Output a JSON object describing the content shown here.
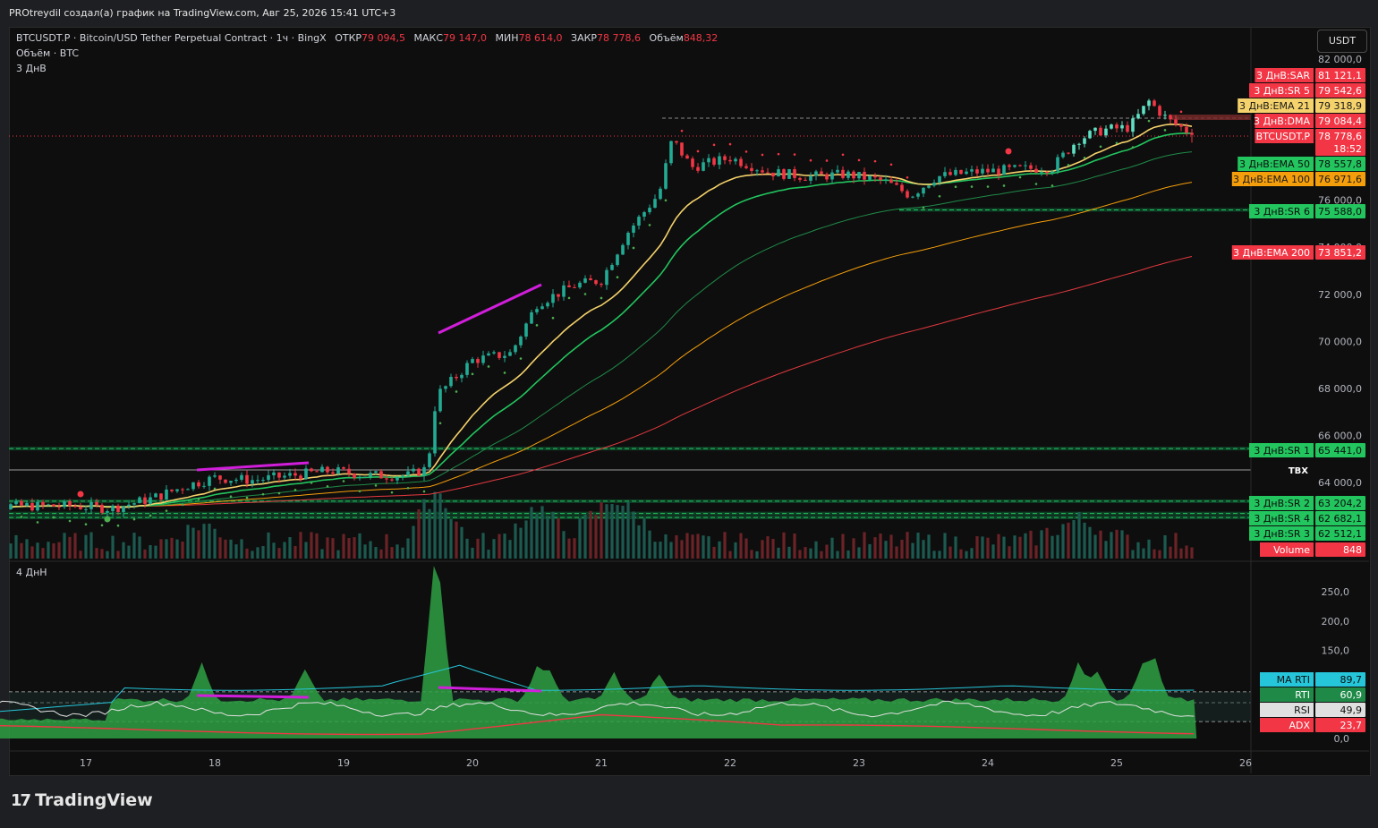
{
  "header": {
    "title": "PROtreydil создал(а) график на TradingView.com, Авг 25, 2026 15:41 UTC+3"
  },
  "legend": {
    "symbol": "BTCUSDT.P · Bitcoin/USD Tether Perpetual Contract · 1ч · BingX",
    "open_label": "ОТКР",
    "open_value": "79 094,5",
    "high_label": "МАКС",
    "high_value": "79 147,0",
    "low_label": "МИН",
    "low_value": "78 614,0",
    "close_label": "ЗАКР",
    "close_value": "78 778,6",
    "volume_label": "Объём",
    "volume_value": "848,32",
    "volume_line": "Объём · BTC",
    "indicator_main": "3 ДнВ",
    "indicator_sub": "4 ДнН"
  },
  "currency_button": "USDT",
  "colors": {
    "up": "#22ab94",
    "up_bright": "#5ee0c2",
    "down": "#f23645",
    "ema21": "#f5d26b",
    "ema50": "#22c55e",
    "ema100": "#f59e0b",
    "ema200": "#e5393f",
    "sar": "#f23645",
    "sr": "#22c55e",
    "magenta": "#d11edb",
    "bg": "#0e0e0e"
  },
  "chart_data": [
    {
      "type": "candlestick",
      "symbol": "BTCUSDT.P",
      "timeframe": "1ч",
      "x_ticks": [
        "17",
        "18",
        "19",
        "20",
        "21",
        "22",
        "23",
        "24",
        "25",
        "26"
      ],
      "y_ticks": [
        "82 000,0",
        "76 000,0",
        "74 000,0",
        "72 000,0",
        "70 000,0",
        "68 000,0",
        "66 000,0",
        "64 000,0"
      ],
      "ylim": [
        61000,
        82400
      ],
      "series_close": [
        {
          "day": 16.9,
          "price": 63000
        },
        {
          "day": 17.2,
          "price": 62900
        },
        {
          "day": 17.5,
          "price": 63300
        },
        {
          "day": 17.8,
          "price": 63900
        },
        {
          "day": 18.0,
          "price": 64200
        },
        {
          "day": 18.3,
          "price": 64100
        },
        {
          "day": 18.6,
          "price": 64300
        },
        {
          "day": 18.9,
          "price": 64500
        },
        {
          "day": 19.2,
          "price": 64300
        },
        {
          "day": 19.5,
          "price": 64300
        },
        {
          "day": 19.65,
          "price": 64600
        },
        {
          "day": 19.72,
          "price": 67700
        },
        {
          "day": 19.8,
          "price": 68100
        },
        {
          "day": 20.0,
          "price": 69200
        },
        {
          "day": 20.3,
          "price": 69500
        },
        {
          "day": 20.5,
          "price": 71600
        },
        {
          "day": 20.8,
          "price": 72400
        },
        {
          "day": 21.0,
          "price": 72600
        },
        {
          "day": 21.2,
          "price": 74600
        },
        {
          "day": 21.45,
          "price": 76300
        },
        {
          "day": 21.55,
          "price": 78600
        },
        {
          "day": 21.7,
          "price": 77400
        },
        {
          "day": 22.0,
          "price": 77800
        },
        {
          "day": 22.3,
          "price": 77200
        },
        {
          "day": 22.6,
          "price": 77000
        },
        {
          "day": 22.9,
          "price": 77100
        },
        {
          "day": 23.2,
          "price": 76800
        },
        {
          "day": 23.4,
          "price": 76200
        },
        {
          "day": 23.6,
          "price": 77000
        },
        {
          "day": 23.9,
          "price": 77200
        },
        {
          "day": 24.2,
          "price": 77300
        },
        {
          "day": 24.5,
          "price": 77400
        },
        {
          "day": 24.7,
          "price": 78600
        },
        {
          "day": 24.9,
          "price": 79000
        },
        {
          "day": 25.1,
          "price": 79100
        },
        {
          "day": 25.25,
          "price": 80200
        },
        {
          "day": 25.4,
          "price": 79400
        },
        {
          "day": 25.6,
          "price": 78778.6
        }
      ],
      "series": [
        {
          "name": "3 ДнВ:EMA 21",
          "last": "79 318,9",
          "last_value": 79318.9
        },
        {
          "name": "3 ДнВ:EMA 50",
          "last": "78 557,8",
          "last_value": 78557.8
        },
        {
          "name": "3 ДнВ:EMA 100",
          "last": "76 971,6",
          "last_value": 76971.6
        },
        {
          "name": "3 ДнВ:EMA 200",
          "last": "73 851,2",
          "last_value": 73851.2
        },
        {
          "name": "3 ДнВ:SAR",
          "last": "81 121,1",
          "last_value": 81121.1
        },
        {
          "name": "3 ДнВ:DMA",
          "last": "79 084,4",
          "last_value": 79084.4
        }
      ],
      "levels": [
        {
          "name": "3 ДнВ:SR 5",
          "value": "79 542,6",
          "price": 79542.6
        },
        {
          "name": "3 ДнВ:SR 6",
          "value": "75 588,0",
          "price": 75588.0
        },
        {
          "name": "3 ДнВ:SR 1",
          "value": "65 441,0",
          "price": 65441.0
        },
        {
          "name": "3 ДнВ:SR 2",
          "value": "63 204,2",
          "price": 63204.2
        },
        {
          "name": "3 ДнВ:SR 4",
          "value": "62 682,1",
          "price": 62682.1
        },
        {
          "name": "3 ДнВ:SR 3",
          "value": "62 512,1",
          "price": 62512.1
        }
      ],
      "current_price": {
        "label": "BTCUSDT.P",
        "value": "78 778,6",
        "countdown": "18:52"
      },
      "tbx_label": "ТВХ",
      "volume": {
        "label": "Volume",
        "value": "848"
      }
    },
    {
      "type": "line",
      "indicator": "4 ДнН",
      "y_ticks": [
        "250,0",
        "200,0",
        "150,0",
        "0,0"
      ],
      "ylim": [
        0,
        280
      ],
      "series": [
        {
          "name": "MA RTI",
          "last": "89,7",
          "last_value": 89.7
        },
        {
          "name": "RTI",
          "last": "60,9",
          "last_value": 60.9
        },
        {
          "name": "RSI",
          "last": "49,9",
          "last_value": 49.9
        },
        {
          "name": "ADX",
          "last": "23,7",
          "last_value": 23.7
        }
      ]
    }
  ]
}
